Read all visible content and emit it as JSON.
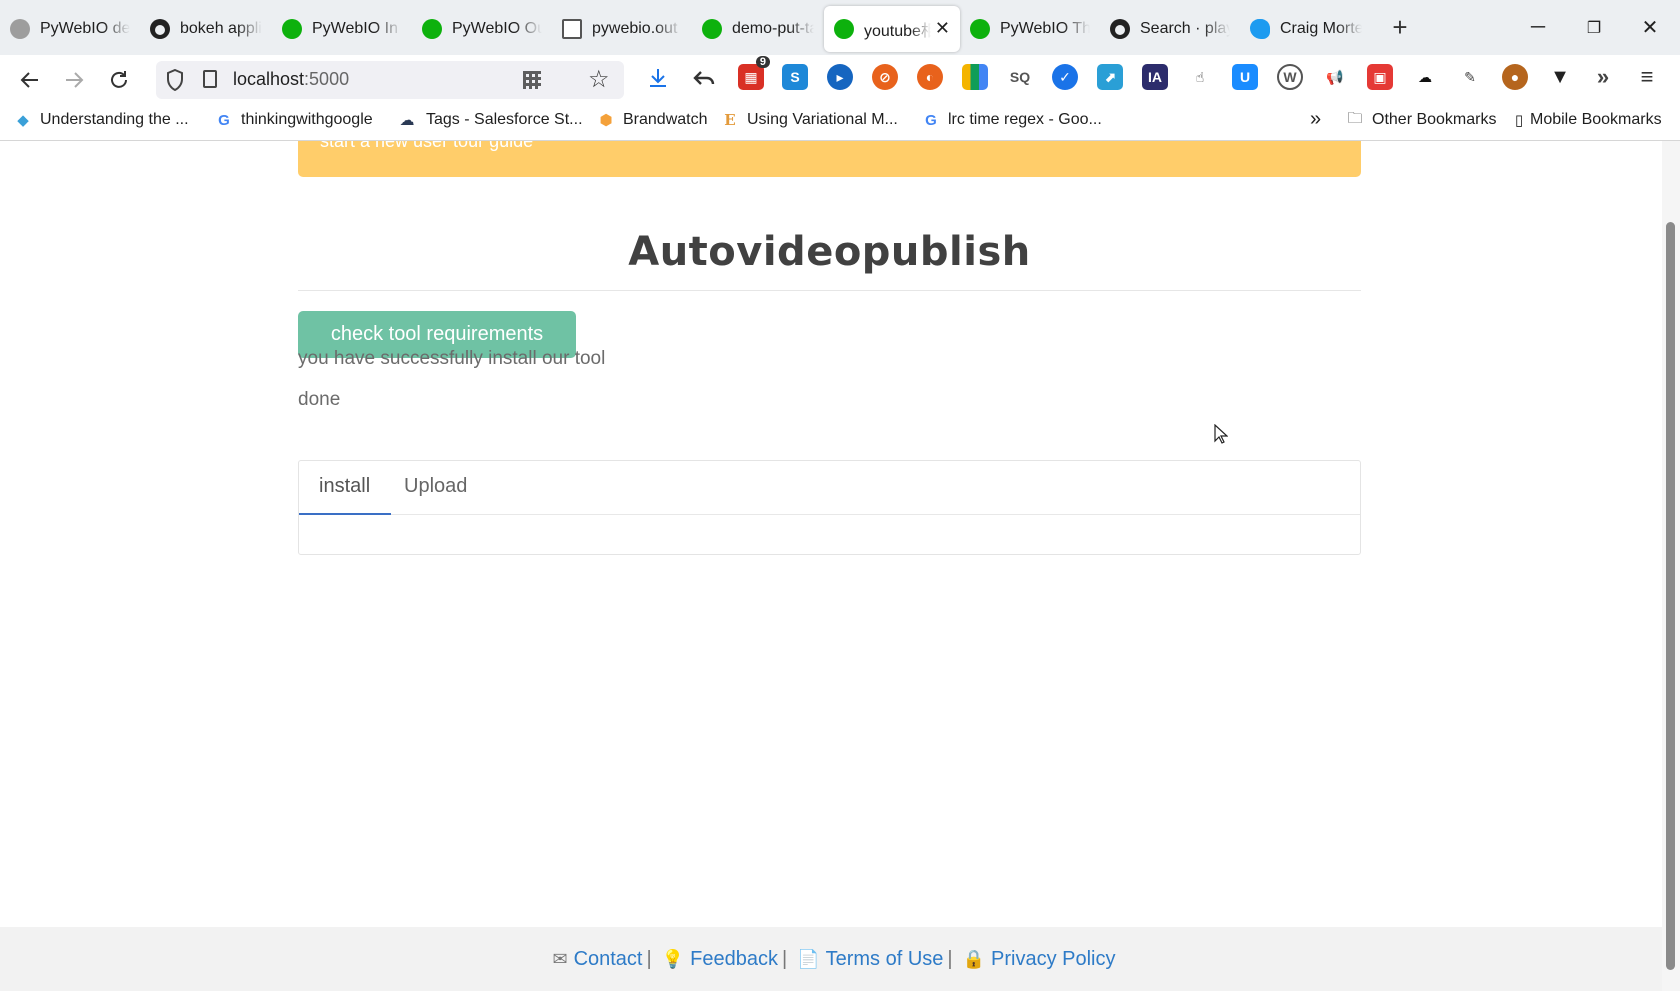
{
  "browser": {
    "tabs": [
      {
        "title": "PyWebIO de",
        "favicon": "grey-dot-icon"
      },
      {
        "title": "bokeh appli",
        "favicon": "github-icon"
      },
      {
        "title": "PyWebIO In",
        "favicon": "green-dot-icon"
      },
      {
        "title": "PyWebIO Ou",
        "favicon": "green-dot-icon"
      },
      {
        "title": "pywebio.out",
        "favicon": "document-icon"
      },
      {
        "title": "demo-put-ta",
        "favicon": "green-dot-icon"
      },
      {
        "title": "youtube相",
        "favicon": "green-dot-icon",
        "active": true
      },
      {
        "title": "PyWebIO Th",
        "favicon": "green-dot-icon"
      },
      {
        "title": "Search · play",
        "favicon": "github-icon"
      },
      {
        "title": "Craig Morte",
        "favicon": "twitter-icon"
      }
    ],
    "new_tab": "+",
    "window": {
      "minimize": "─",
      "restore": "❐",
      "close": "✕"
    },
    "address": {
      "host": "localhost",
      "port": ":5000"
    },
    "extension_badge": "9",
    "bookmarks": [
      "Understanding the ...",
      "thinkingwithgoogle",
      "Tags - Salesforce St...",
      "Brandwatch",
      "Using Variational M...",
      "lrc time regex - Goo..."
    ],
    "bookmarks_overflow": "»",
    "other_bookmarks": "Other Bookmarks",
    "mobile_bookmarks": "Mobile Bookmarks"
  },
  "page": {
    "alert_text": "start a new user tour guide",
    "heading": "Autovideopublish",
    "check_button": "check tool requirements",
    "message_1": "you have successfully install our tool",
    "message_2": "done",
    "tabs": [
      "install",
      "Upload"
    ],
    "footer": {
      "contact": "Contact",
      "feedback": "Feedback",
      "terms": "Terms of Use",
      "privacy": "Privacy Policy",
      "separator": "|"
    }
  },
  "colors": {
    "alert_bg": "#ffcd6a",
    "button_bg": "#6fc2a4",
    "tab_underline": "#3a6fc5",
    "link": "#2e7bc7"
  }
}
